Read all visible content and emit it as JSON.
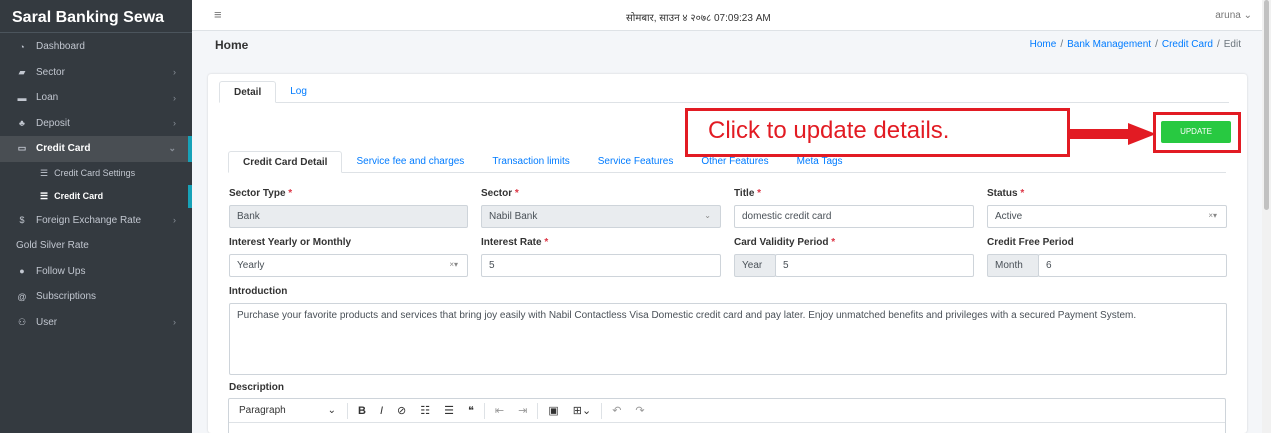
{
  "brand": "Saral Banking Sewa",
  "sidebar": {
    "items": [
      {
        "label": "Dashboard",
        "icon": "dashboard-icon"
      },
      {
        "label": "Sector",
        "icon": "sector-icon"
      },
      {
        "label": "Loan",
        "icon": "loan-icon"
      },
      {
        "label": "Deposit",
        "icon": "deposit-icon"
      },
      {
        "label": "Credit Card",
        "icon": "credit-card-icon"
      },
      {
        "label": "Foreign Exchange Rate",
        "icon": "dollar-icon"
      },
      {
        "label": "Gold Silver Rate"
      },
      {
        "label": "Follow Ups",
        "icon": "follow-icon"
      },
      {
        "label": "Subscriptions",
        "icon": "at-icon"
      },
      {
        "label": "User",
        "icon": "users-icon"
      }
    ],
    "sub_items": [
      {
        "label": "Credit Card Settings"
      },
      {
        "label": "Credit Card"
      }
    ]
  },
  "topbar": {
    "datetime": "सोमबार, साउन ४ २०७८  07:09:23 AM",
    "user": "aruna"
  },
  "page": {
    "title": "Home",
    "breadcrumb": [
      "Home",
      "Bank Management",
      "Credit Card",
      "Edit"
    ]
  },
  "tabs_top": [
    "Detail",
    "Log"
  ],
  "update_button": "UPDATE",
  "callout": "Click to update details.",
  "tabs_inner": [
    "Credit Card Detail",
    "Service fee and charges",
    "Transaction limits",
    "Service Features",
    "Other Features",
    "Meta Tags"
  ],
  "form": {
    "sector_type": {
      "label": "Sector Type",
      "value": "Bank"
    },
    "sector": {
      "label": "Sector",
      "value": "Nabil Bank"
    },
    "title": {
      "label": "Title",
      "value": "domestic credit card"
    },
    "status": {
      "label": "Status",
      "value": "Active"
    },
    "interest_mode": {
      "label": "Interest Yearly or Monthly",
      "value": "Yearly"
    },
    "interest_rate": {
      "label": "Interest Rate",
      "value": "5"
    },
    "validity": {
      "label": "Card Validity Period",
      "addon": "Year",
      "value": "5"
    },
    "credit_free": {
      "label": "Credit Free Period",
      "addon": "Month",
      "value": "6"
    },
    "introduction": {
      "label": "Introduction",
      "value": "Purchase your favorite products and services that bring joy easily with Nabil Contactless Visa Domestic credit card and pay later. Enjoy unmatched benefits and privileges with a secured Payment System."
    },
    "description": {
      "label": "Description",
      "paragraph": "Paragraph"
    }
  },
  "colors": {
    "sidebar_bg": "#343a40",
    "accent": "#17a2b8",
    "link": "#007bff",
    "update_green": "#28c941",
    "callout_red": "#e21b23"
  }
}
